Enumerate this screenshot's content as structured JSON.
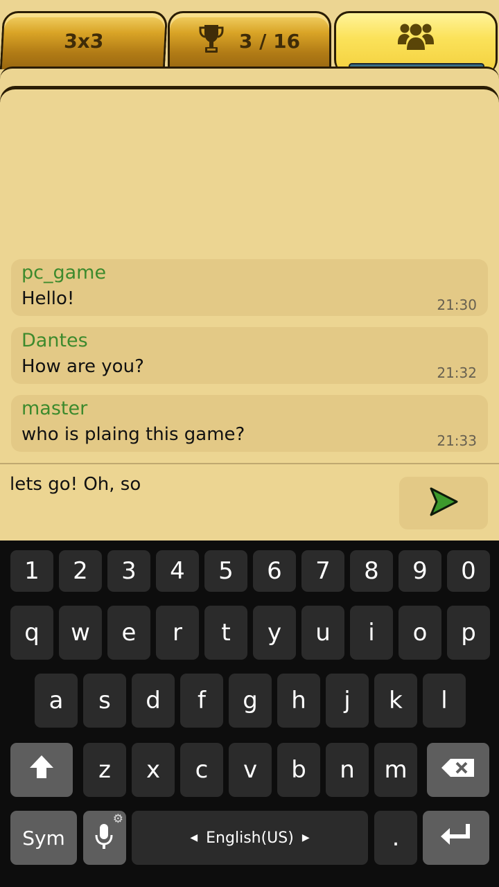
{
  "tabs": [
    {
      "label": "3x3"
    },
    {
      "label": "3 / 16"
    },
    {
      "label": ""
    }
  ],
  "chat_progress": 1.0,
  "messages": [
    {
      "user": "pc_game",
      "text": "Hello!",
      "time": "21:30"
    },
    {
      "user": "Dantes",
      "text": "How are you?",
      "time": "21:32"
    },
    {
      "user": "master",
      "text": "who is plaing this game?",
      "time": "21:33"
    }
  ],
  "input": {
    "value": "lets go! Oh, so"
  },
  "keyboard": {
    "row_numbers": [
      "1",
      "2",
      "3",
      "4",
      "5",
      "6",
      "7",
      "8",
      "9",
      "0"
    ],
    "row_top": [
      "q",
      "w",
      "e",
      "r",
      "t",
      "y",
      "u",
      "i",
      "o",
      "p"
    ],
    "row_middle": [
      "a",
      "s",
      "d",
      "f",
      "g",
      "h",
      "j",
      "k",
      "l"
    ],
    "row_bottom": [
      "z",
      "x",
      "c",
      "v",
      "b",
      "n",
      "m"
    ],
    "sym_label": "Sym",
    "language_label": "English(US)",
    "period_label": "."
  },
  "colors": {
    "username": "#3d8a2d",
    "send_arrow": "#3d9a2c",
    "tab_active": "#fbe25a",
    "tab_inactive": "#c38c1c"
  }
}
